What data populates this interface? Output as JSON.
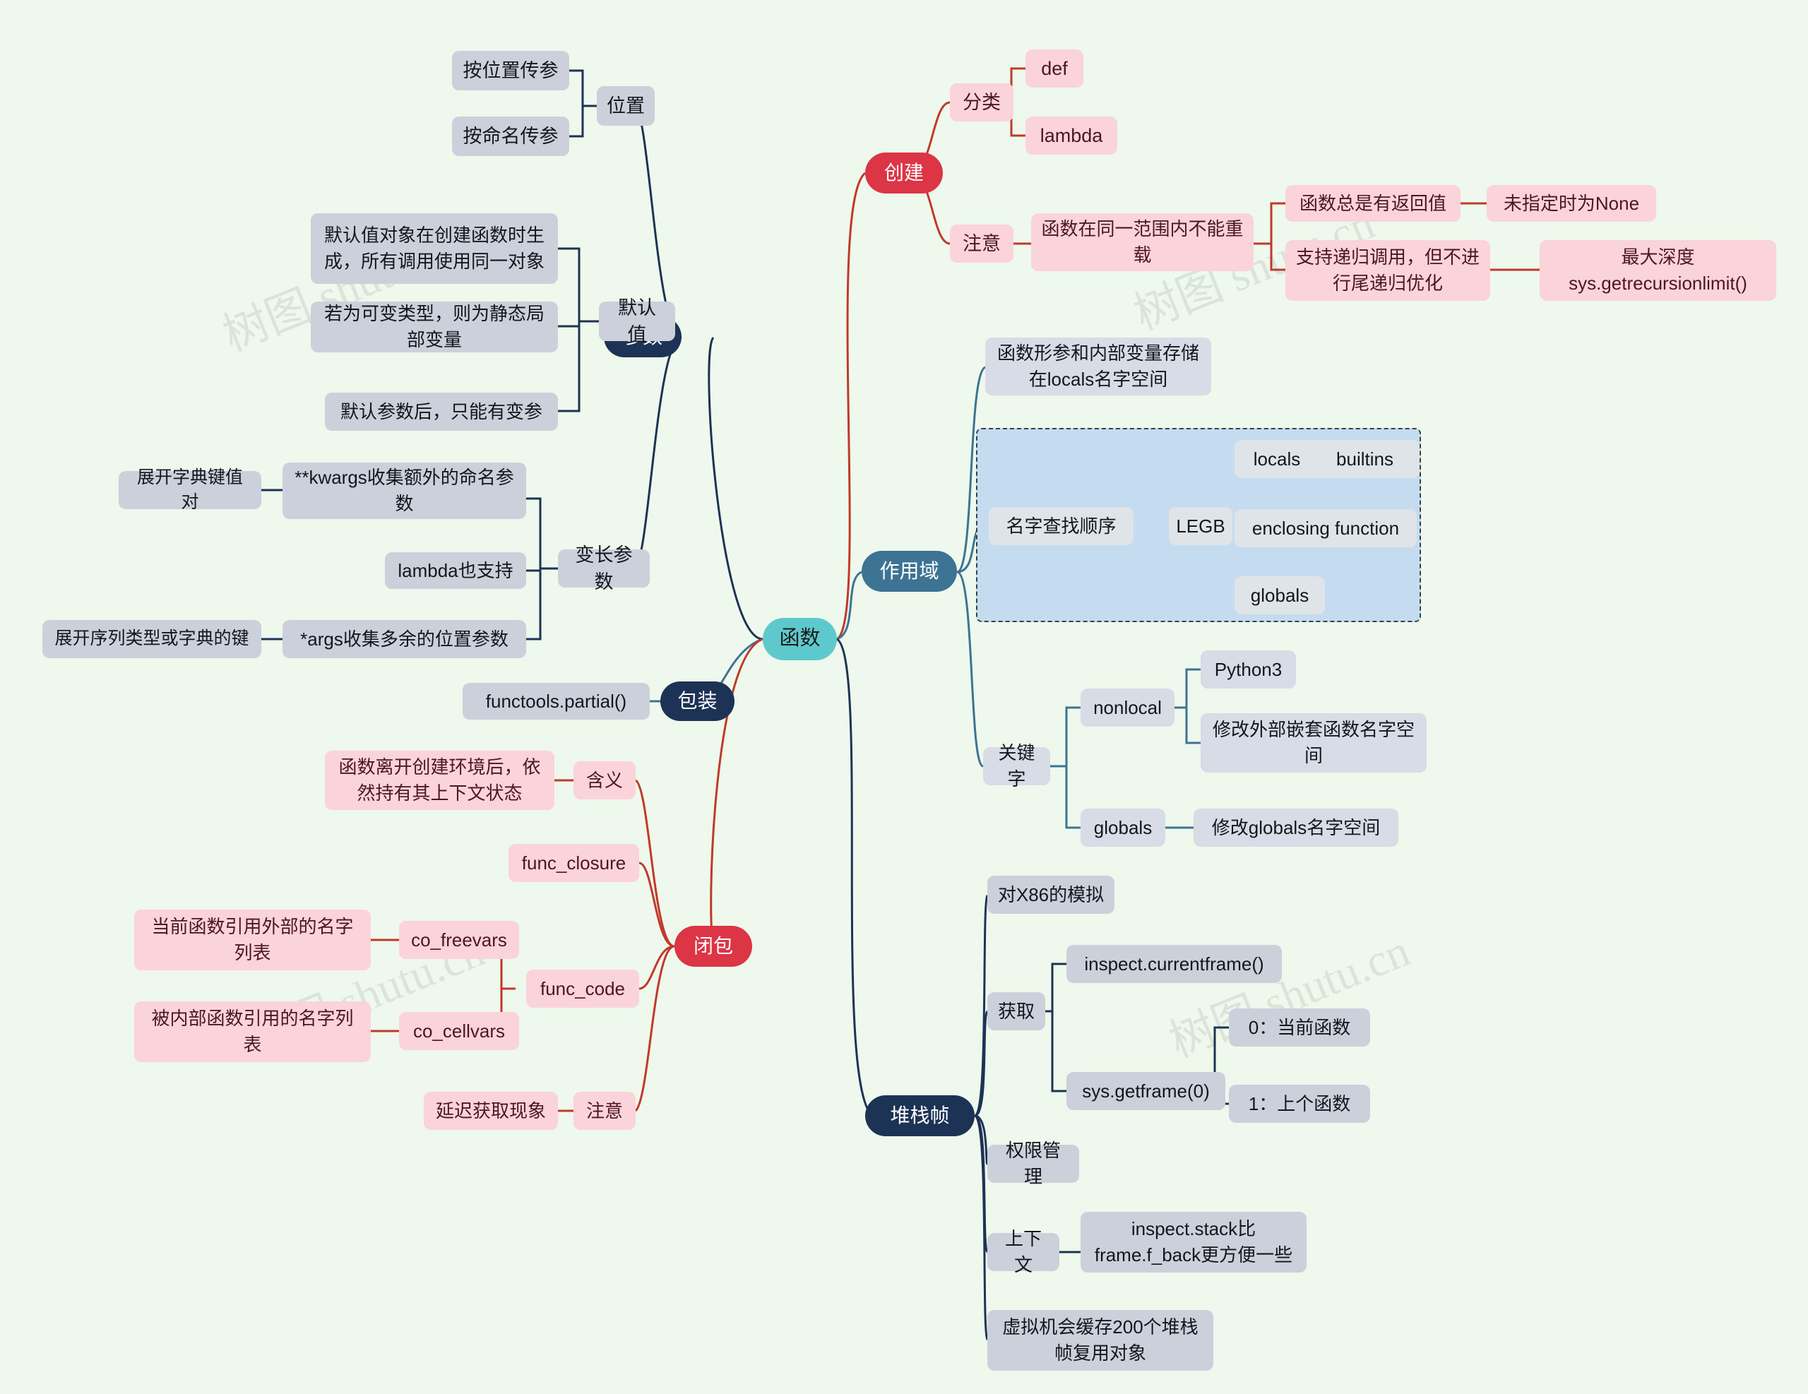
{
  "meta": {
    "background_color": "#eef8ec",
    "title_node": "函数",
    "watermark_text": "树图 shutu.cn"
  },
  "palette": {
    "root": "#5ec9cc",
    "branch_params": "#1d3355",
    "branch_scope": "#3d7393",
    "branch_wrap": "#1d3355",
    "branch_stack": "#1d3355",
    "branch_create": "#dc3545",
    "branch_closure": "#dc3545",
    "gray_node": "#ccd0db",
    "pink_node": "#fbd3da",
    "legb_box": "#c5dcf0"
  },
  "root": {
    "label": "函数"
  },
  "branches": {
    "params": {
      "label": "参数",
      "children": {
        "position": {
          "label": "位置",
          "items": [
            "按位置传参",
            "按命名传参"
          ]
        },
        "default": {
          "label": "默认值",
          "items": [
            "默认值对象在创建函数时生成，所有调用使用同一对象",
            "若为可变类型，则为静态局部变量",
            "默认参数后，只能有变参"
          ]
        },
        "varargs": {
          "label": "变长参数",
          "items": [
            {
              "label": "**kwargs收集额外的命名参数",
              "note": "展开字典键值对"
            },
            {
              "label": "lambda也支持",
              "note": ""
            },
            {
              "label": "*args收集多余的位置参数",
              "note": "展开序列类型或字典的键"
            }
          ]
        }
      }
    },
    "create": {
      "label": "创建",
      "children": {
        "classify": {
          "label": "分类",
          "items": [
            "def",
            "lambda"
          ]
        },
        "notice": {
          "label": "注意",
          "items": [
            {
              "label": "函数在同一范围内不能重载",
              "sub": []
            },
            {
              "label": "函数总是有返回值",
              "sub": [
                "未指定时为None"
              ]
            },
            {
              "label": "支持递归调用，但不进行尾递归优化",
              "sub": [
                "最大深度sys.getrecursionlimit()"
              ]
            }
          ]
        }
      }
    },
    "scope": {
      "label": "作用域",
      "children": {
        "locals_note": "函数形参和内部变量存储在locals名字空间",
        "legb": {
          "label": "名字查找顺序",
          "mid": "LEGB",
          "items": [
            "locals",
            "enclosing function",
            "globals"
          ],
          "locals_child": "builtins"
        },
        "keywords": {
          "label": "关键字",
          "items": [
            {
              "label": "nonlocal",
              "sub": [
                "Python3",
                "修改外部嵌套函数名字空间"
              ]
            },
            {
              "label": "globals",
              "sub": [
                "修改globals名字空间"
              ]
            }
          ]
        }
      }
    },
    "wrap": {
      "label": "包装",
      "items": [
        "functools.partial()"
      ]
    },
    "closure": {
      "label": "闭包",
      "children": {
        "meaning": {
          "label": "含义",
          "items": [
            "函数离开创建环境后，依然持有其上下文状态"
          ]
        },
        "func_closure": {
          "label": "func_closure",
          "items": []
        },
        "func_code": {
          "label": "func_code",
          "items": [
            {
              "label": "co_freevars",
              "note": "当前函数引用外部的名字列表"
            },
            {
              "label": "co_cellvars",
              "note": "被内部函数引用的名字列表"
            }
          ]
        },
        "notice": {
          "label": "注意",
          "items": [
            "延迟获取现象"
          ]
        }
      }
    },
    "stack": {
      "label": "堆栈帧",
      "children": [
        {
          "label": "对X86的模拟",
          "sub": []
        },
        {
          "label": "获取",
          "sub": [
            {
              "label": "inspect.currentframe()",
              "sub2": []
            },
            {
              "label": "sys.getframe(0)",
              "sub2": [
                "0：当前函数",
                "1：上个函数"
              ]
            }
          ]
        },
        {
          "label": "权限管理",
          "sub": []
        },
        {
          "label": "上下文",
          "sub": [
            {
              "label": "inspect.stack比frame.f_back更方便一些",
              "sub2": []
            }
          ]
        },
        {
          "label": "虚拟机会缓存200个堆栈帧复用对象",
          "sub": []
        }
      ]
    }
  }
}
